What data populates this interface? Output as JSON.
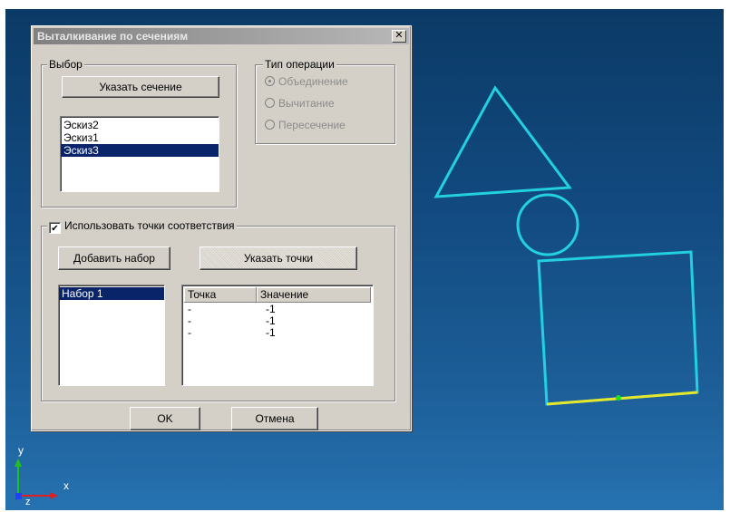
{
  "dialog": {
    "title": "Выталкивание по сечениям",
    "close_glyph": "✕",
    "selection": {
      "legend": "Выбор",
      "pick_button": "Указать сечение",
      "sketches": [
        {
          "label": "Эскиз2",
          "selected": false
        },
        {
          "label": "Эскиз1",
          "selected": false
        },
        {
          "label": "Эскиз3",
          "selected": true
        }
      ]
    },
    "operation": {
      "legend": "Тип операции",
      "options": [
        {
          "label": "Объединение",
          "checked": true
        },
        {
          "label": "Вычитание",
          "checked": false
        },
        {
          "label": "Пересечение",
          "checked": false
        }
      ]
    },
    "correspondence": {
      "checkbox_label": "Использовать точки соответствия",
      "checked": true,
      "check_glyph": "✔",
      "add_set_button": "Добавить набор",
      "pick_points_button": "Указать точки",
      "sets": [
        {
          "label": "Набор 1",
          "selected": true
        }
      ],
      "table": {
        "columns": [
          "Точка",
          "Значение"
        ],
        "rows": [
          [
            "-",
            "-1"
          ],
          [
            "-",
            "-1"
          ],
          [
            "-",
            "-1"
          ]
        ]
      }
    },
    "ok_button": "OK",
    "cancel_button": "Отмена"
  },
  "viewport": {
    "colors": {
      "sketch": "#22d0e0",
      "selected_edge": "#e6e62a",
      "point": "#20e020"
    },
    "axes": {
      "x_label": "x",
      "y_label": "y",
      "z_label": "z"
    }
  }
}
